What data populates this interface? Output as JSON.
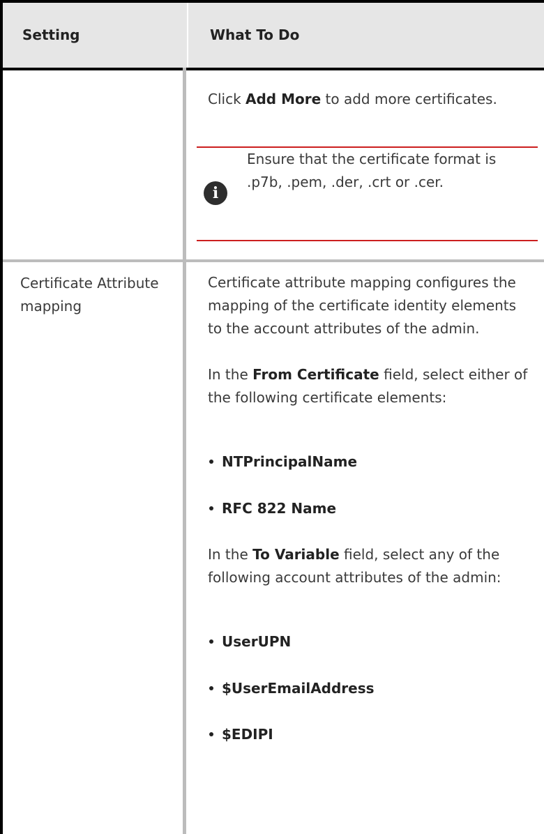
{
  "table": {
    "headers": {
      "setting": "Setting",
      "what_to_do": "What To Do"
    },
    "row1": {
      "setting": "",
      "text_before": "Click ",
      "bold": "Add More",
      "text_after": " to add more certificates.",
      "note_icon": "info-icon",
      "note": "Ensure that the certificate format is .p7b, .pem, .der, .crt or .cer."
    },
    "row2": {
      "setting": "Certificate Attribute mapping",
      "intro": "Certificate attribute mapping configures the mapping of the certificate identity elements to the account attributes of the admin.",
      "from_before": "In the ",
      "from_bold": "From Certificate",
      "from_after": " field, select either of the following certificate elements:",
      "from_items": [
        "NTPrincipalName",
        "RFC 822 Name"
      ],
      "to_before": "In the ",
      "to_bold": "To Variable",
      "to_after": " field, select any of the following account attributes of the admin:",
      "to_items": [
        "UserUPN",
        "$UserEmailAddress",
        "$EDIPI"
      ]
    }
  },
  "colors": {
    "header_bg": "#e6e6e6",
    "note_rule": "#cc1f1f",
    "border": "#000000",
    "grid": "#bcbcbc"
  }
}
